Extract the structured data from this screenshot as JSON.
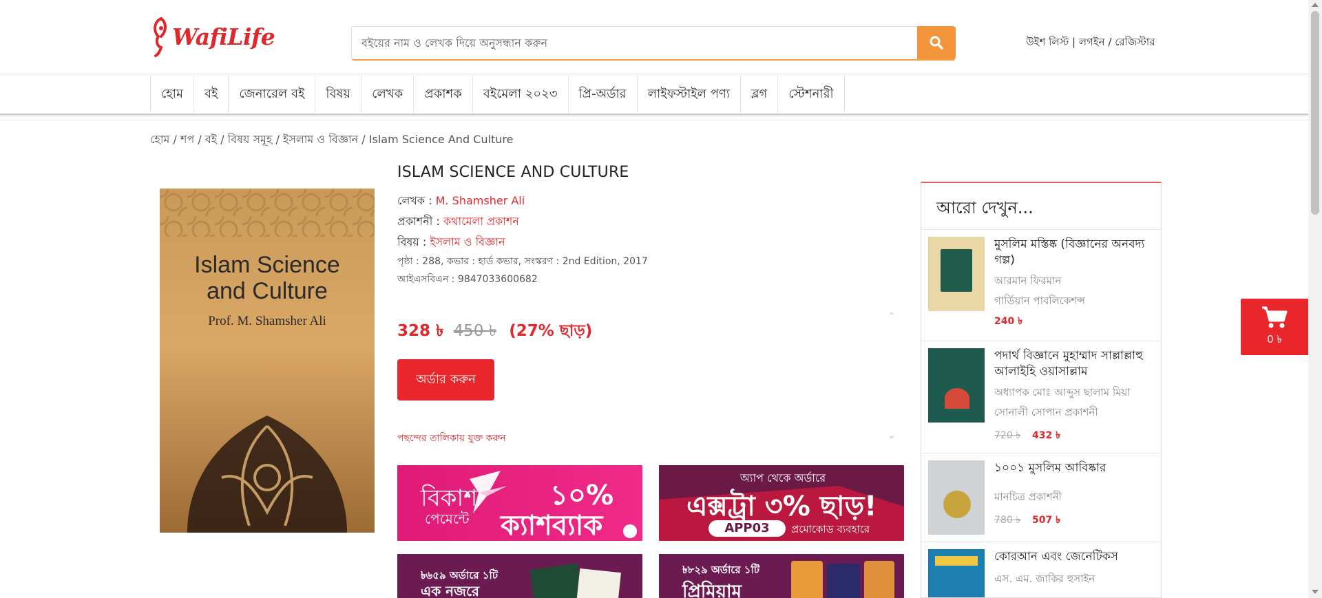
{
  "brand": {
    "logo_text": "WafiLife"
  },
  "search": {
    "placeholder": "বইয়ের নাম ও লেখক দিয়ে অনুসন্ধান করুন"
  },
  "account": {
    "wishlist": "উইশ লিস্ট",
    "login": "লগইন",
    "register": "রেজিস্টার"
  },
  "nav": [
    "হোম",
    "বই",
    "জেনারেল বই",
    "বিষয়",
    "লেখক",
    "প্রকাশক",
    "বইমেলা ২০২৩",
    "প্রি-অর্ডার",
    "লাইফস্টাইল পণ্য",
    "ব্লগ",
    "স্টেশনারী"
  ],
  "breadcrumb": [
    "হোম",
    "শপ",
    "বই",
    "বিষয় সমূহ",
    "ইসলাম ও বিজ্ঞান",
    "Islam Science And Culture"
  ],
  "cover": {
    "title_line1": "Islam Science",
    "title_line2": "and Culture",
    "author": "Prof. M. Shamsher Ali"
  },
  "product": {
    "title": "ISLAM SCIENCE AND CULTURE",
    "author_label": "লেখক :",
    "author": "M. Shamsher Ali",
    "publisher_label": "প্রকাশনী :",
    "publisher": "কথামেলা প্রকাশন",
    "subject_label": "বিষয় :",
    "subject": "ইসলাম ও বিজ্ঞান",
    "specs": "পৃষ্ঠা : 288, কভার : হার্ড কভার, সংস্করণ : 2nd Edition, 2017",
    "isbn": "আইএসবিএন : 9847033600682",
    "price": "328 ৳",
    "old_price": "450 ৳",
    "discount": "(27% ছাড়)",
    "order_button": "অর্ডার করুন",
    "wishlist_link": "পছন্দের তালিকায় যুক্ত করুন"
  },
  "banners": {
    "b1": {
      "line1": "বিকাশ",
      "line2": "পেমেন্টে",
      "big": "১০%",
      "big2": "ক্যাশব্যাক"
    },
    "b2": {
      "top": "অ্যাপ থেকে অর্ডারে",
      "big": "এক্সট্রা ৩% ছাড়!",
      "code": "APP03",
      "code_suffix": "প্রমোকোড ব্যবহারে"
    },
    "b3": {
      "line1": "৳৬৫৯ অর্ডারে ১টি",
      "line2": "এক নজরে"
    },
    "b4": {
      "line1": "৳৮২৯ অর্ডারে ১টি",
      "line2": "প্রিমিয়াম"
    }
  },
  "sidebar": {
    "heading": "আরো দেখুন...",
    "items": [
      {
        "title": "মুসলিম মস্তিষ্ক (বিজ্ঞানের অনবদ্য গল্প)",
        "author": "আরমান ফিরমান",
        "publisher": "গার্ডিয়ান পাবলিকেশন্স",
        "old_price": "",
        "price": "240 ৳",
        "thumb_color": "#e9d8a6",
        "thumb_inner": "#1f5c4a"
      },
      {
        "title": "পদার্থ বিজ্ঞানে মুহাম্মাদ সাল্লাল্লাহু আলাইহি ওয়াসাল্লাম",
        "author": "অধ্যাপক মোঃ আব্দুস ছালাম মিয়া",
        "publisher": "সোনালী সোপান প্রকাশনী",
        "old_price": "720 ৳",
        "price": "432 ৳",
        "thumb_color": "#1e5a4e",
        "thumb_inner": "#d64a3a"
      },
      {
        "title": "১০০১ মুসলিম আবিষ্কার",
        "author": "মানচিত্র প্রকাশনী",
        "publisher": "",
        "old_price": "780 ৳",
        "price": "507 ৳",
        "thumb_color": "#cfd3d6",
        "thumb_inner": "#c9a43c"
      },
      {
        "title": "কোরআন এবং জেনেটিকস",
        "author": "এস. এম. জাকির হুসাইন",
        "publisher": "",
        "old_price": "",
        "price": "",
        "thumb_color": "#1d7fb0",
        "thumb_inner": "#f2c744"
      }
    ]
  },
  "cart": {
    "amount": "0 ৳"
  },
  "colors": {
    "brand_red": "#e8262b",
    "search_orange": "#f3963b",
    "bkash_pink": "#e01a77",
    "promo_purple": "#6a1a45"
  }
}
